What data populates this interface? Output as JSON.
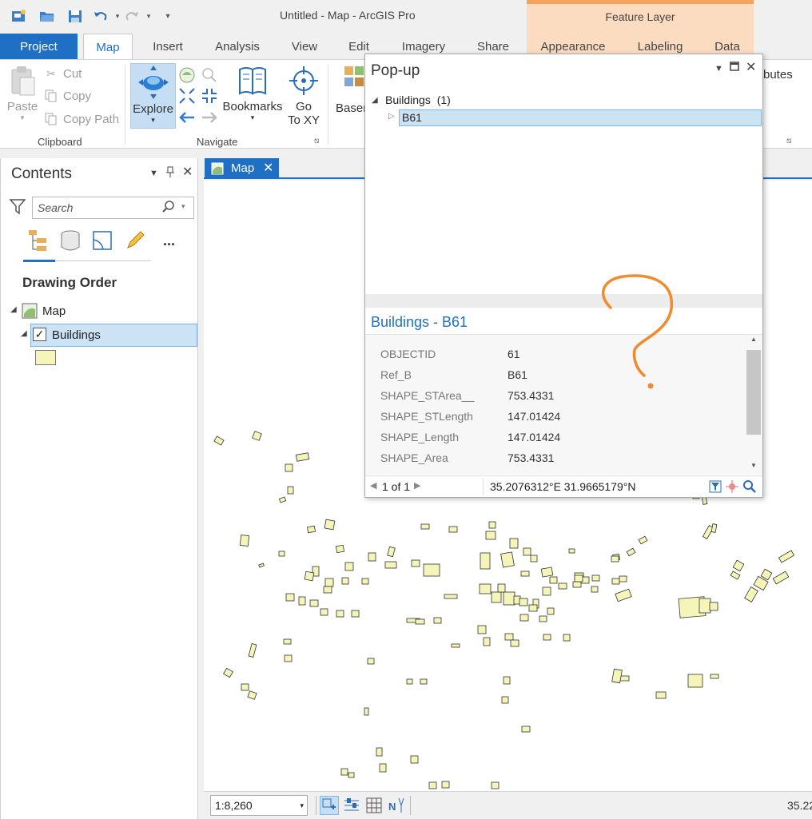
{
  "window": {
    "title": "Untitled - Map - ArcGIS Pro",
    "contextual_tab_group": "Feature Layer"
  },
  "ribbon_tabs": [
    "Project",
    "Map",
    "Insert",
    "Analysis",
    "View",
    "Edit",
    "Imagery",
    "Share",
    "Appearance",
    "Labeling",
    "Data"
  ],
  "clipboard": {
    "paste": "Paste",
    "cut": "Cut",
    "copy": "Copy",
    "copy_path": "Copy Path",
    "group_label": "Clipboard"
  },
  "navigate": {
    "explore": "Explore",
    "bookmarks": "Bookmarks",
    "go_to_xy_line1": "Go",
    "go_to_xy_line2": "To XY",
    "group_label": "Navigate"
  },
  "layer": {
    "basemap_partial": "Basem"
  },
  "right_partial_label": "butes",
  "contents": {
    "title": "Contents",
    "search_placeholder": "Search",
    "more": "...",
    "drawing_order": "Drawing Order",
    "map_item": "Map",
    "layer_item": "Buildings",
    "layer_visible": true,
    "symbol_color": "#f5f5b9"
  },
  "map_view": {
    "tab_label": "Map",
    "scale": "1:8,260",
    "coord_partial": "35.22"
  },
  "popup": {
    "title": "Pop-up",
    "layer_node": "Buildings",
    "layer_count": "(1)",
    "feature_node": "B61",
    "detail_title": "Buildings - B61",
    "fields": [
      {
        "name": "OBJECTID",
        "value": "61"
      },
      {
        "name": "Ref_B",
        "value": "B61"
      },
      {
        "name": "SHAPE_STArea__",
        "value": "753.4331"
      },
      {
        "name": "SHAPE_STLength",
        "value": "147.01424"
      },
      {
        "name": "SHAPE_Length",
        "value": "147.01424"
      },
      {
        "name": "SHAPE_Area",
        "value": "753.4331"
      }
    ],
    "pager": "1 of 1",
    "coordinates": "35.2076312°E 31.9665179°N"
  },
  "annotation": {
    "mark": "?",
    "color": "#f28a2e"
  },
  "colors": {
    "accent": "#1f6fc5",
    "building_fill": "#f5f5b9",
    "building_stroke": "#333333"
  }
}
